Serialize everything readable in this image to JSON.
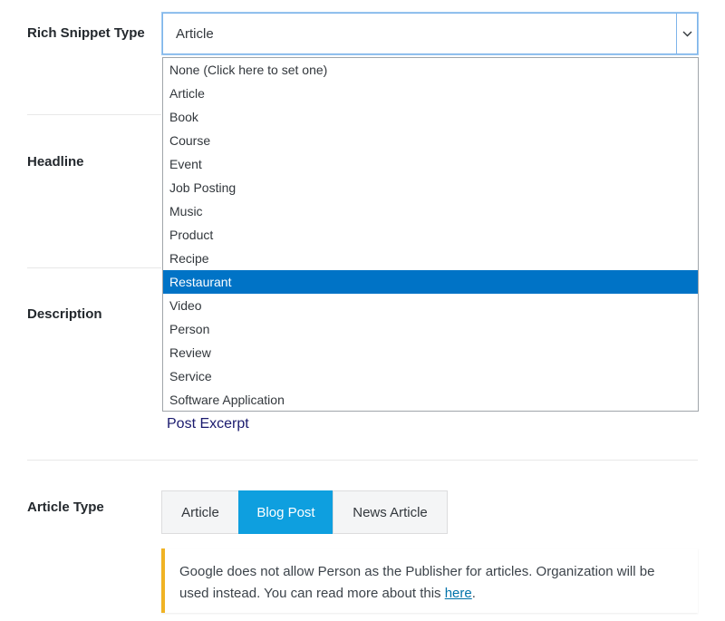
{
  "rich_snippet": {
    "label": "Rich Snippet Type",
    "selected": "Article",
    "options": [
      "None (Click here to set one)",
      "Article",
      "Book",
      "Course",
      "Event",
      "Job Posting",
      "Music",
      "Product",
      "Recipe",
      "Restaurant",
      "Video",
      "Person",
      "Review",
      "Service",
      "Software Application"
    ],
    "highlighted_option": "Restaurant"
  },
  "headline": {
    "label": "Headline"
  },
  "description": {
    "label": "Description",
    "excerpt_link": "Post Excerpt"
  },
  "article_type": {
    "label": "Article Type",
    "options": [
      "Article",
      "Blog Post",
      "News Article"
    ],
    "selected": "Blog Post"
  },
  "notice": {
    "text": "Google does not allow Person as the Publisher for articles. Organization will be used instead. You can read more about this ",
    "link_text": "here",
    "suffix": "."
  },
  "colors": {
    "accent": "#0e9fdf",
    "highlight": "#0073c6",
    "notice_border": "#f0b324"
  },
  "icons": {
    "select_arrow": "chevron-down-icon"
  }
}
